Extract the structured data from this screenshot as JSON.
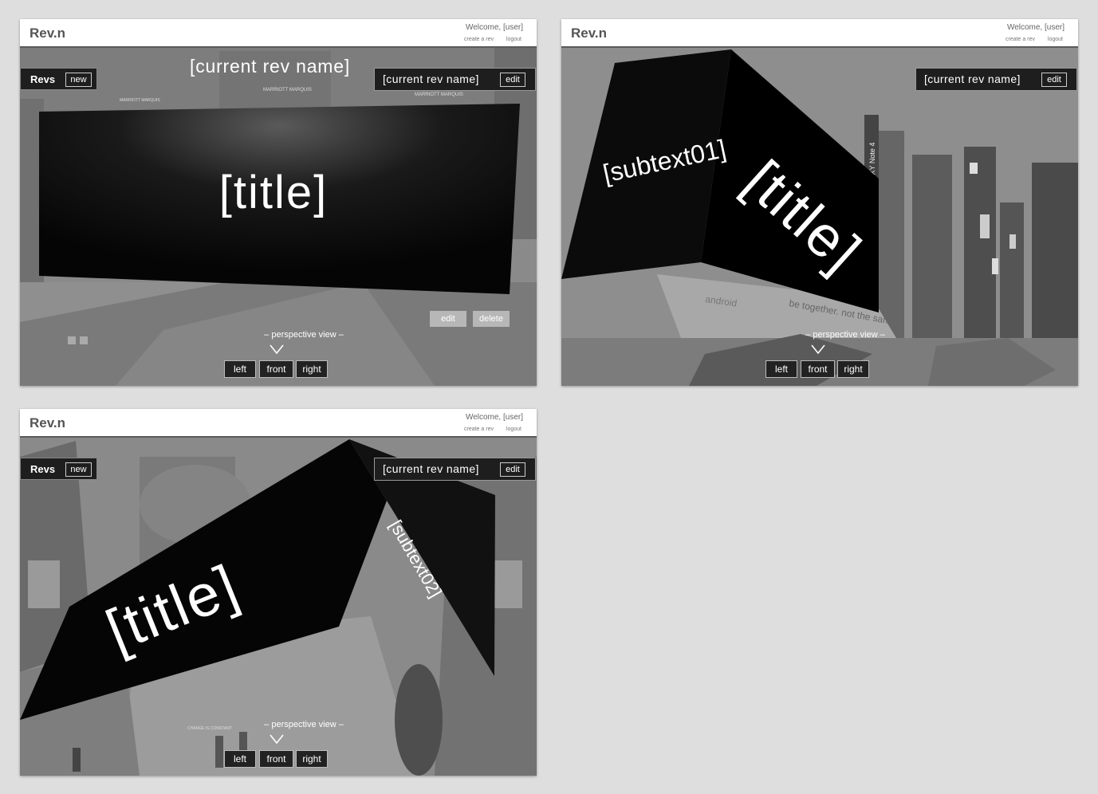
{
  "header": {
    "logo": "Rev.n",
    "welcome": "Welcome, [user]",
    "create_link": "create a rev",
    "logout_link": "logout"
  },
  "revs_panel": {
    "label": "Revs",
    "new_label": "new"
  },
  "current_rev": {
    "name": "[current rev name]",
    "edit_label": "edit"
  },
  "billboard": {
    "title": "[title]",
    "subtext1": "[subtext01]",
    "subtext2": "[subtext02]"
  },
  "actions": {
    "edit_label": "edit",
    "delete_label": "delete"
  },
  "perspective": {
    "label": "– perspective view –",
    "left_label": "left",
    "front_label": "front",
    "right_label": "right"
  },
  "background": {
    "front": {
      "sign_1": "MARRIOTT MARQUIS",
      "sign_2": "MARRIOTT MARQUIS",
      "sign_3": "MARRIOTT MARQUIS"
    },
    "right": {
      "sign_1": "android",
      "sign_2": "be together. not the same",
      "sign_3": "Samsung GALAXY Note 4"
    },
    "left": {
      "sign_1": "CHANGE IS CONSTANT"
    }
  },
  "colors": {
    "header_bg": "#ffffff",
    "bar_bg": "#1e1e1e",
    "page_bg": "#dedede",
    "photo_gray": "#8d8d8d"
  }
}
